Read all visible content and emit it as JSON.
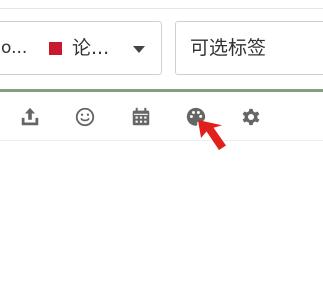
{
  "form": {
    "category_select": {
      "prefix": "o...",
      "swatch_color": "#c8192e",
      "value": "论...",
      "icon": "chevron-down-icon"
    },
    "tag_input": {
      "placeholder": "可选标签",
      "value": ""
    }
  },
  "toolbar": {
    "accent_color": "#7fa17e",
    "items": [
      {
        "icon": "upload-icon"
      },
      {
        "icon": "smiley-icon"
      },
      {
        "icon": "calendar-icon"
      },
      {
        "icon": "palette-icon"
      },
      {
        "icon": "gear-icon"
      }
    ]
  },
  "cursor": {
    "icon": "arrow-cursor-icon",
    "color": "#e0201c"
  }
}
